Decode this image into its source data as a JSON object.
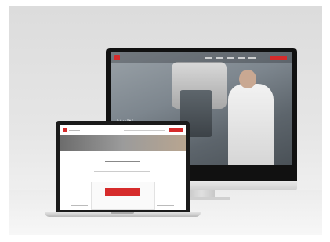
{
  "scene": {
    "imac": {
      "hero_text": "Multi-"
    },
    "macbook": {}
  },
  "colors": {
    "brand_red": "#d62b2b",
    "background": "#e6e6e6"
  }
}
